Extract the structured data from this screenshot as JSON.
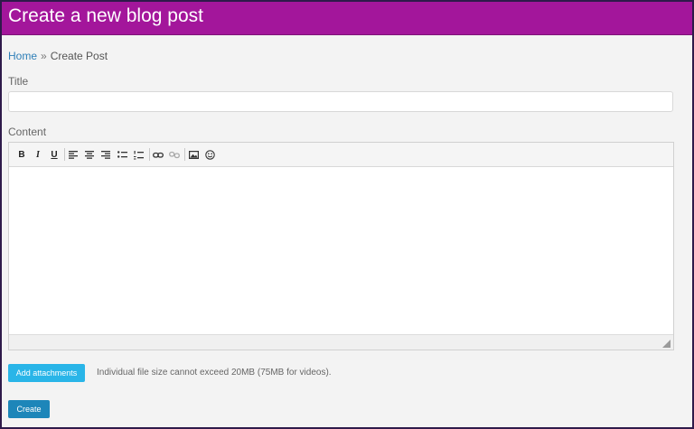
{
  "header": {
    "title": "Create a new blog post"
  },
  "breadcrumb": {
    "home": "Home",
    "separator": "»",
    "current": "Create Post"
  },
  "form": {
    "title_label": "Title",
    "title_value": "",
    "title_placeholder": "",
    "content_label": "Content",
    "content_value": ""
  },
  "toolbar": {
    "bold": "B",
    "italic": "I",
    "underline": "U",
    "icons": [
      "bold-icon",
      "italic-icon",
      "underline-icon",
      "align-left-icon",
      "align-center-icon",
      "align-right-icon",
      "bullet-list-icon",
      "numbered-list-icon",
      "link-icon",
      "unlink-icon",
      "image-icon",
      "emoji-icon"
    ]
  },
  "attachments": {
    "button_label": "Add attachments",
    "note": "Individual file size cannot exceed 20MB (75MB for videos)."
  },
  "actions": {
    "create_label": "Create"
  },
  "colors": {
    "header_bg": "#a3169b",
    "link": "#2e7fb8",
    "attach_button": "#29b5e8",
    "create_button": "#1d86b9",
    "page_bg": "#f3f3f3"
  }
}
